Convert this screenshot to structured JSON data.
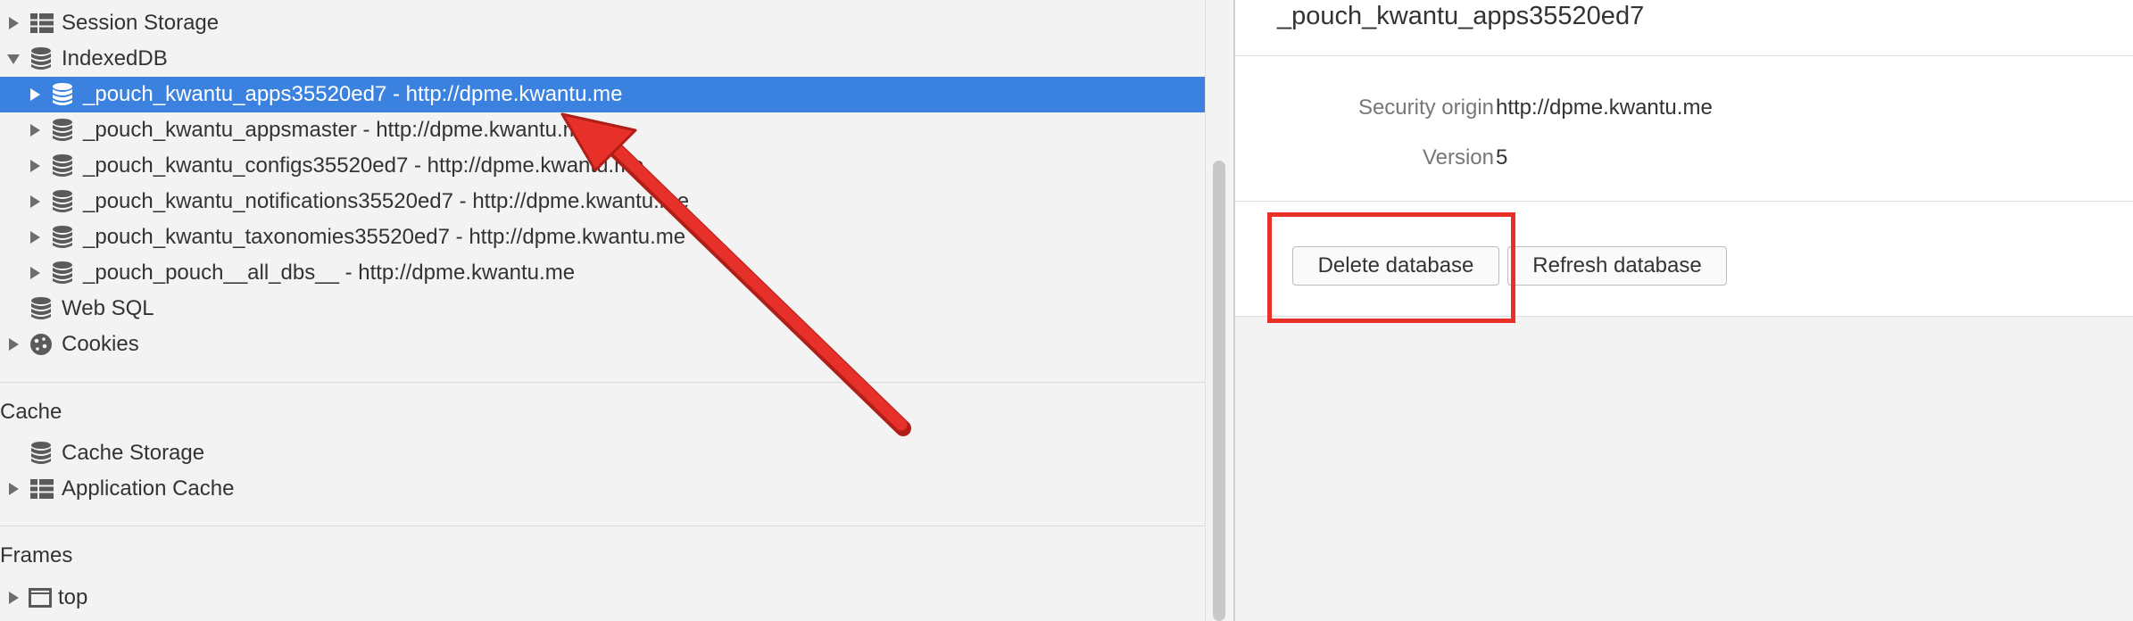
{
  "sidebar": {
    "storage_items": [
      {
        "label": "Session Storage",
        "icon": "grid-icon",
        "expanded": false
      },
      {
        "label": "IndexedDB",
        "icon": "database-icon",
        "expanded": true
      }
    ],
    "indexeddb_children": [
      {
        "label": "_pouch_kwantu_apps35520ed7 - http://dpme.kwantu.me",
        "selected": true
      },
      {
        "label": "_pouch_kwantu_appsmaster - http://dpme.kwantu.me",
        "selected": false
      },
      {
        "label": "_pouch_kwantu_configs35520ed7 - http://dpme.kwantu.me",
        "selected": false
      },
      {
        "label": "_pouch_kwantu_notifications35520ed7 - http://dpme.kwantu.me",
        "selected": false
      },
      {
        "label": "_pouch_kwantu_taxonomies35520ed7 - http://dpme.kwantu.me",
        "selected": false
      },
      {
        "label": "_pouch_pouch__all_dbs__ - http://dpme.kwantu.me",
        "selected": false
      }
    ],
    "web_sql": "Web SQL",
    "cookies": "Cookies",
    "cache_section": {
      "title": "Cache",
      "items": [
        {
          "label": "Cache Storage",
          "icon": "database-icon"
        },
        {
          "label": "Application Cache",
          "icon": "grid-icon"
        }
      ]
    },
    "frames_section": {
      "title": "Frames",
      "items": [
        {
          "label": "top",
          "icon": "frame-icon"
        }
      ]
    }
  },
  "main": {
    "title": "_pouch_kwantu_apps35520ed7",
    "security_origin_label": "Security origin",
    "security_origin_value": "http://dpme.kwantu.me",
    "version_label": "Version",
    "version_value": "5",
    "delete_button": "Delete database",
    "refresh_button": "Refresh database"
  },
  "colors": {
    "selection": "#3b82e0",
    "annotation": "#e8302a",
    "panel_bg": "#f3f3f3"
  }
}
